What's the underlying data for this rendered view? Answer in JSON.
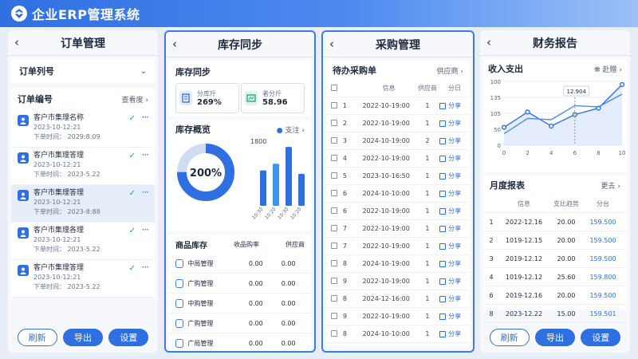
{
  "app": {
    "title": "企业ERP管理系统"
  },
  "colors": {
    "primary": "#2f6fe0",
    "success": "#1aa87a",
    "panel_bg": "#f6f8fc"
  },
  "orders": {
    "title": "订单管理",
    "dropdown_label": "订单列号",
    "section_title": "订单编号",
    "section_link": "查看度",
    "items": [
      {
        "name": "客户市集理名称",
        "date": "2023-10-12:21",
        "time": "下单时间：  2029:8:09"
      },
      {
        "name": "客户市集理答理",
        "date": "2023-10-12:21",
        "time": "下单时间：  2023-5.22"
      },
      {
        "name": "客户市集理答理",
        "date": "2023-10-12:21",
        "time": "下单时间：  2023-8:88"
      },
      {
        "name": "客户市集理各理",
        "date": "2023-10-12:21",
        "time": "下单时间：  2023-5.22"
      },
      {
        "name": "客户市集理答理",
        "date": "2023-10-12:21",
        "time": "下单时间：  2023-5.22"
      }
    ],
    "buttons": {
      "refresh": "刷新",
      "export": "导出",
      "settings": "设置"
    }
  },
  "inventory": {
    "title": "库存同步",
    "sync_title": "库存同步",
    "stat1": {
      "label": "分库斤",
      "value": "269%"
    },
    "stat2": {
      "label": "者分斤",
      "value": "58.96"
    },
    "overview_title": "库存概览",
    "overview_link": "支注",
    "donut_value": "200%",
    "donut_fraction": 0.75,
    "bar_chart": {
      "y_max_label": "1800",
      "values": [
        1050,
        1250,
        1750,
        950
      ],
      "x_labels": [
        "10:30",
        "10:20",
        "10:30",
        "10:20"
      ],
      "ymax": 1800
    },
    "products_title": "商品库存",
    "col_headers": [
      "收品购率",
      "供应商"
    ],
    "products": [
      {
        "name": "中局管理",
        "v1": "0.00",
        "v2": "0.00"
      },
      {
        "name": "广购管理",
        "v1": "0.00",
        "v2": "0.00"
      },
      {
        "name": "中购管理",
        "v1": "0.00",
        "v2": "0.00"
      },
      {
        "name": "广购管理",
        "v1": "0.00",
        "v2": "0.00"
      },
      {
        "name": "广局管理",
        "v1": "0.00",
        "v2": "0.00"
      }
    ]
  },
  "purchase": {
    "title": "采购管理",
    "section_title": "待办采购单",
    "section_link": "供应商",
    "headers": [
      "信息",
      "供应商",
      "分日"
    ],
    "rows": [
      {
        "no": "1",
        "date": "2022-10-19:00",
        "qty": "1",
        "action": "分享"
      },
      {
        "no": "2",
        "date": "2022-10-19:00",
        "qty": "1",
        "action": "分享"
      },
      {
        "no": "3",
        "date": "2024-10-19:00",
        "qty": "2",
        "action": "分享"
      },
      {
        "no": "4",
        "date": "2022-10-19:00",
        "qty": "1",
        "action": "分享"
      },
      {
        "no": "5",
        "date": "2023-10-16:50",
        "qty": "1",
        "action": "分享"
      },
      {
        "no": "6",
        "date": "2024-10-10:00",
        "qty": "1",
        "action": "分享"
      },
      {
        "no": "6",
        "date": "2022-10-19:00",
        "qty": "1",
        "action": "分享"
      },
      {
        "no": "7",
        "date": "2022-10-19:00",
        "qty": "1",
        "action": "分享"
      },
      {
        "no": "7",
        "date": "2022-10-19:00",
        "qty": "1",
        "action": "分享"
      },
      {
        "no": "8",
        "date": "2024-10-19:00",
        "qty": "1",
        "action": "分享"
      },
      {
        "no": "9",
        "date": "2022-10-19:00",
        "qty": "1",
        "action": "分享"
      },
      {
        "no": "8",
        "date": "2024-12-16:00",
        "qty": "1",
        "action": "分享"
      },
      {
        "no": "9",
        "date": "2022-10-19:00",
        "qty": "1",
        "action": "分享"
      },
      {
        "no": "8",
        "date": "2024-10-10:00",
        "qty": "1",
        "action": "分享"
      }
    ]
  },
  "finance": {
    "title": "财务报告",
    "chart_title": "收入支出",
    "chart_link": "赴赠",
    "chart_data": {
      "type": "line",
      "x_ticks": [
        "0",
        "2",
        "4",
        "6",
        "8",
        "10"
      ],
      "y_ticks": [
        "100",
        "135",
        "105",
        "50",
        "0"
      ],
      "y_tick_positions": [
        100,
        75,
        50,
        25,
        0
      ],
      "series": [
        {
          "x": [
            0,
            2,
            4,
            6,
            8,
            10
          ],
          "y": [
            28,
            52,
            30,
            48,
            58,
            95
          ]
        },
        {
          "x": [
            0,
            2,
            4,
            6,
            8,
            10
          ],
          "y": [
            18,
            42,
            40,
            62,
            60,
            80
          ]
        }
      ],
      "xlim": [
        0,
        10
      ],
      "ylim": [
        0,
        100
      ],
      "tooltip": "12.904",
      "tooltip_x": 6
    },
    "report_title": "月度报表",
    "report_link": "更去",
    "headers": [
      "信息",
      "支比趋势",
      "分台"
    ],
    "rows": [
      {
        "no": "1",
        "date": "2022-12.16",
        "amount": "20.00",
        "total": "159.500"
      },
      {
        "no": "2",
        "date": "1019-12.15",
        "amount": "20.00",
        "total": "159.500"
      },
      {
        "no": "3",
        "date": "2019-12.12",
        "amount": "20.00",
        "total": "159.500"
      },
      {
        "no": "4",
        "date": "1019-12.12",
        "amount": "25.60",
        "total": "159.800"
      },
      {
        "no": "6",
        "date": "2019-12.16",
        "amount": "20.00",
        "total": "159.500"
      },
      {
        "no": "8",
        "date": "2023-12.22",
        "amount": "15.00",
        "total": "159.501"
      }
    ],
    "buttons": {
      "refresh": "刷新",
      "export": "导出",
      "settings": "设置"
    }
  }
}
